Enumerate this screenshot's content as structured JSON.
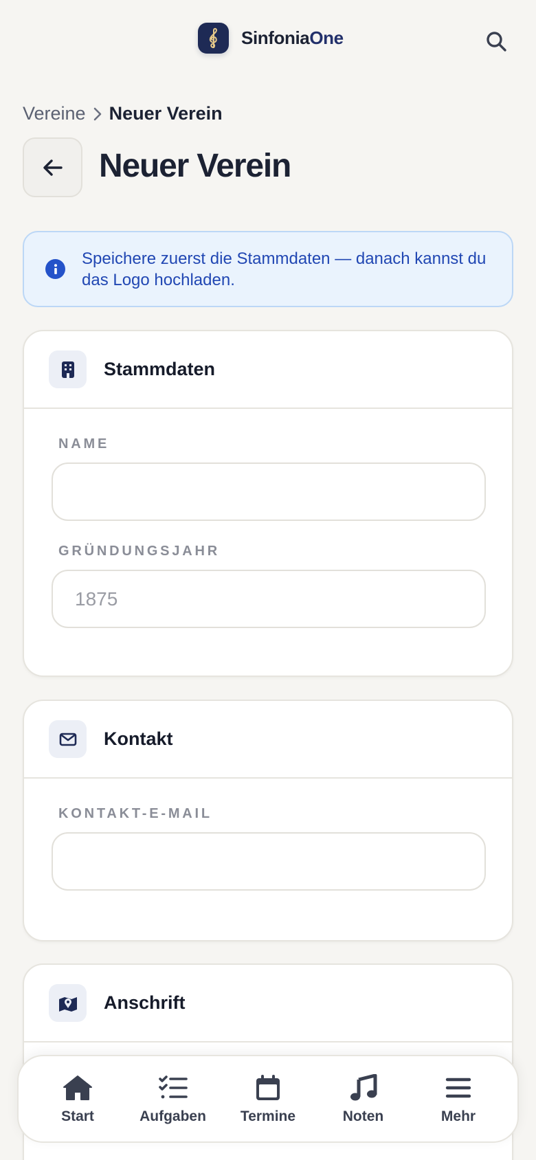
{
  "header": {
    "brand_part1": "Sinfonia",
    "brand_part2": "One",
    "brand_icon": "treble-clef-icon",
    "search_icon": "search-icon"
  },
  "breadcrumb": {
    "parent": "Vereine",
    "current": "Neuer Verein"
  },
  "page_title": "Neuer Verein",
  "info_banner": {
    "text": "Speichere zuerst die Stammdaten — danach kannst du das Logo hochladen.",
    "icon": "info-icon"
  },
  "sections": {
    "stammdaten": {
      "title": "Stammdaten",
      "icon": "building-icon",
      "name_label": "NAME",
      "name_value": "",
      "year_label": "GRÜNDUNGSJAHR",
      "year_placeholder": "1875",
      "year_value": ""
    },
    "kontakt": {
      "title": "Kontakt",
      "icon": "mail-icon",
      "email_label": "KONTAKT-E-MAIL",
      "email_value": ""
    },
    "anschrift": {
      "title": "Anschrift",
      "icon": "map-icon"
    }
  },
  "bottom_nav": [
    {
      "label": "Start",
      "icon": "home-icon"
    },
    {
      "label": "Aufgaben",
      "icon": "tasks-icon"
    },
    {
      "label": "Termine",
      "icon": "calendar-icon"
    },
    {
      "label": "Noten",
      "icon": "music-note-icon"
    },
    {
      "label": "Mehr",
      "icon": "menu-icon"
    }
  ],
  "colors": {
    "background": "#f6f5f2",
    "brand_navy": "#1e2a55",
    "info_text": "#2147b3",
    "info_bg": "#eaf3fd"
  }
}
